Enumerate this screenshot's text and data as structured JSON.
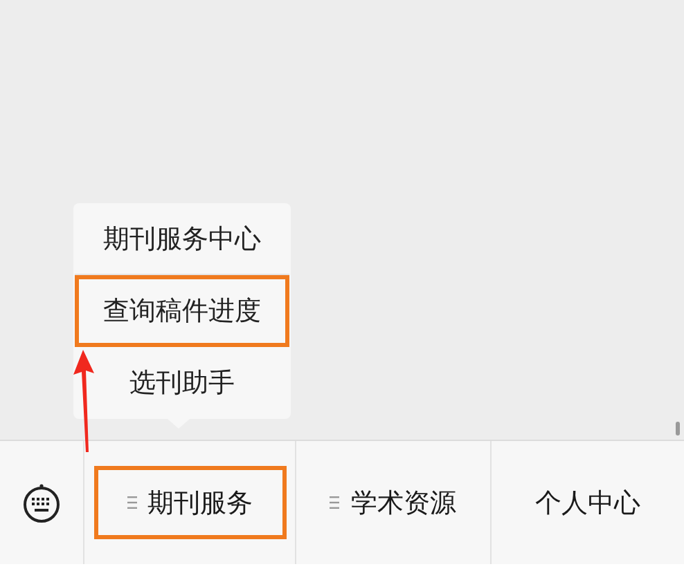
{
  "popup_menu": {
    "items": [
      {
        "label": "期刊服务中心",
        "highlighted": false
      },
      {
        "label": "查询稿件进度",
        "highlighted": true
      },
      {
        "label": "选刊助手",
        "highlighted": false
      }
    ]
  },
  "menu_bar": {
    "items": [
      {
        "label": "期刊服务",
        "has_submenu": true,
        "highlighted": true
      },
      {
        "label": "学术资源",
        "has_submenu": true,
        "highlighted": false
      },
      {
        "label": "个人中心",
        "has_submenu": false,
        "highlighted": false
      }
    ]
  }
}
